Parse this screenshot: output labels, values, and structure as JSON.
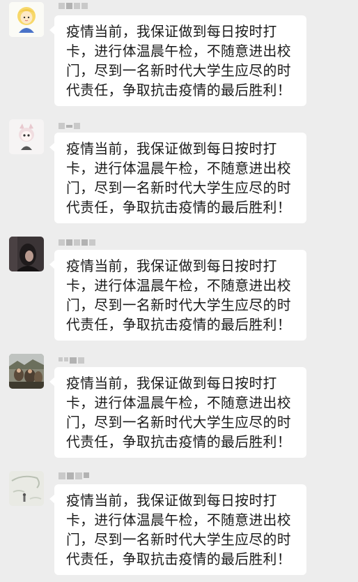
{
  "chat": {
    "background": "#ededed",
    "bubble_color": "#ffffff",
    "messages": [
      {
        "avatar_icon": "cartoon-blonde-girl-icon",
        "text": "疫情当前，我保证做到每日按时打卡，进行体温晨午检，不随意进出校门，尽到一名新时代大学生应尽的时代责任，争取抗击疫情的最后胜利！"
      },
      {
        "avatar_icon": "cartoon-cat-girl-icon",
        "text": "疫情当前，我保证做到每日按时打卡，进行体温晨午检，不随意进出校门，尽到一名新时代大学生应尽的时代责任，争取抗击疫情的最后胜利！"
      },
      {
        "avatar_icon": "dark-portrait-photo-icon",
        "text": "疫情当前，我保证做到每日按时打卡，进行体温晨午检，不随意进出校门，尽到一名新时代大学生应尽的时代责任，争取抗击疫情的最后胜利！"
      },
      {
        "avatar_icon": "outdoor-group-photo-icon",
        "text": "疫情当前，我保证做到每日按时打卡，进行体温晨午检，不随意进出校门，尽到一名新时代大学生应尽的时代责任，争取抗击疫情的最后胜利！"
      },
      {
        "avatar_icon": "sketch-illustration-icon",
        "text": "疫情当前，我保证做到每日按时打卡，进行体温晨午检，不随意进出校门，尽到一名新时代大学生应尽的时代责任，争取抗击疫情的最后胜利！"
      }
    ]
  }
}
